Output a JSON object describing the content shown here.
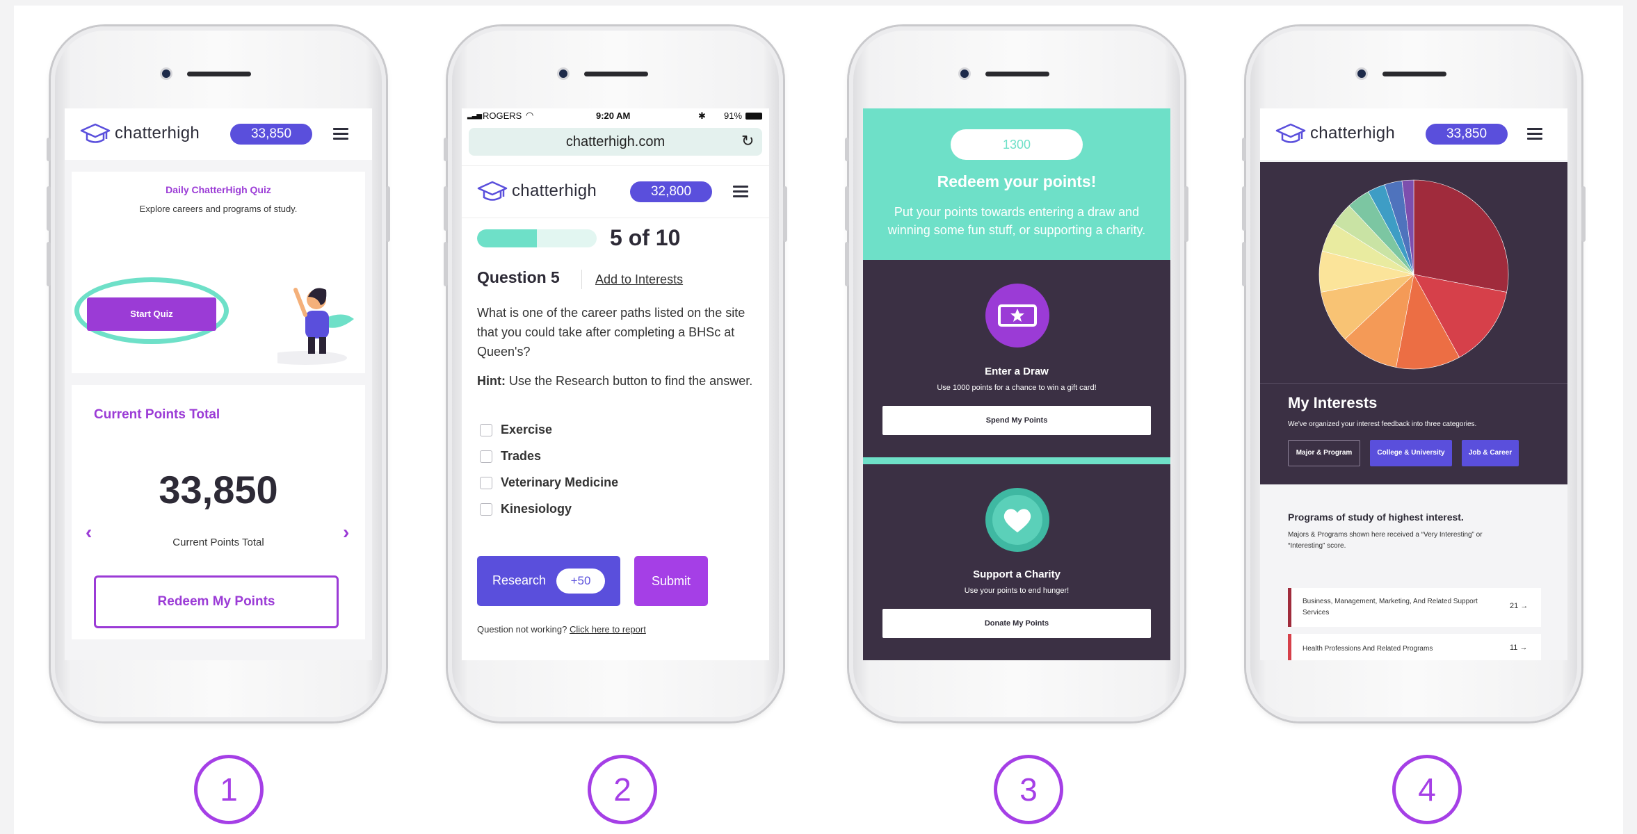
{
  "colors": {
    "accent_purple": "#9b3bd6",
    "indigo": "#5a4fdc",
    "teal": "#6ee0c8",
    "dark_panel": "#3b3044"
  },
  "step_numbers": [
    "1",
    "2",
    "3",
    "4"
  ],
  "brand": {
    "name": "chatterhigh"
  },
  "phone1": {
    "points_badge": "33,850",
    "quiz_title": "Daily ChatterHigh Quiz",
    "quiz_subtitle": "Explore careers and programs of study.",
    "start_button": "Start Quiz",
    "points_heading": "Current Points Total",
    "points_value": "33,850",
    "points_label": "Current Points Total",
    "prev_icon": "chevron-left-icon",
    "next_icon": "chevron-right-icon",
    "redeem_button": "Redeem My Points"
  },
  "phone2": {
    "status": {
      "carrier": "ROGERS",
      "time": "9:20 AM",
      "battery": "91%"
    },
    "url": "chatterhigh.com",
    "points_badge": "32,800",
    "progress_text": "5 of 10",
    "progress_fraction": 0.5,
    "question_title": "Question 5",
    "add_interests": "Add to Interests",
    "question_text": "What is one of the career paths listed on the site that you could take after completing a BHSc at Queen's?",
    "hint_label": "Hint:",
    "hint_text": "Use the Research button to find the answer.",
    "options": [
      "Exercise",
      "Trades",
      "Veterinary Medicine",
      "Kinesiology"
    ],
    "research_button": "Research",
    "research_bonus": "+50",
    "submit_button": "Submit",
    "report_prefix": "Question not working?",
    "report_link": "Click here to report"
  },
  "phone3": {
    "points_badge": "1300",
    "title": "Redeem your points!",
    "subtitle": "Put your points towards entering a draw and winning some fun stuff, or supporting a charity.",
    "draw_title": "Enter a Draw",
    "draw_text": "Use 1000 points for a chance to win a gift card!",
    "draw_button": "Spend My Points",
    "charity_title": "Support a Charity",
    "charity_text": "Use your points to end hunger!",
    "charity_button": "Donate My Points"
  },
  "phone4": {
    "points_badge": "33,850",
    "interests_title": "My Interests",
    "interests_text": "We've organized your interest feedback into three categories.",
    "tabs": [
      "Major & Program",
      "College & University",
      "Job & Career"
    ],
    "programs_title": "Programs of study of highest interest.",
    "programs_text": "Majors & Programs shown here received a “Very Interesting” or “Interesting” score.",
    "programs": [
      {
        "name": "Business, Management, Marketing, And Related Support Services",
        "count": "21"
      },
      {
        "name": "Health Professions And Related Programs",
        "count": "11"
      }
    ]
  },
  "chart_data": {
    "type": "pie",
    "values": [
      28,
      14,
      11,
      10,
      9,
      7,
      5,
      4,
      4,
      3,
      3,
      2
    ],
    "colors": [
      "#a02b3c",
      "#d6404a",
      "#ec6e44",
      "#f49a57",
      "#f8c374",
      "#fbe49a",
      "#e9eba0",
      "#c9e3a4",
      "#7cc6a2",
      "#3e9dc5",
      "#4f73bd",
      "#7d4fae"
    ]
  }
}
